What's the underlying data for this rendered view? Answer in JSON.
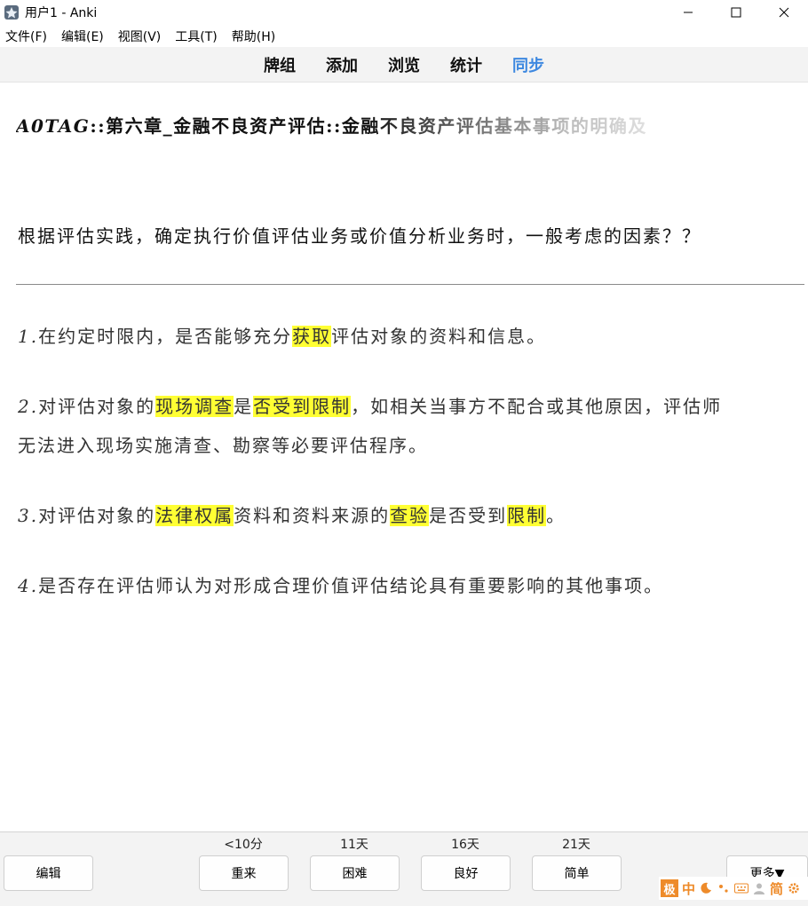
{
  "window": {
    "title": "用户1 - Anki"
  },
  "menu": [
    "文件(F)",
    "编辑(E)",
    "视图(V)",
    "工具(T)",
    "帮助(H)"
  ],
  "toolbar": {
    "decks": "牌组",
    "add": "添加",
    "browse": "浏览",
    "stats": "统计",
    "sync": "同步"
  },
  "card": {
    "deck_tag": "A0TAG",
    "deck_rest": "::第六章_金融不良资产评估::金融不良资产评估基本事项的明确及",
    "question": "根据评估实践，确定执行价值评估业务或价值分析业务时，一般考虑的因素？？",
    "answers": [
      {
        "parts": [
          {
            "text": "1.",
            "hl": false
          },
          {
            "text": "在约定时限内，是否能够充分",
            "hl": false
          },
          {
            "text": "获取",
            "hl": true
          },
          {
            "text": "评估对象的资料和信息。",
            "hl": false
          }
        ]
      },
      {
        "parts": [
          {
            "text": "2.",
            "hl": false
          },
          {
            "text": "对评估对象的",
            "hl": false
          },
          {
            "text": "现场调查",
            "hl": true
          },
          {
            "text": "是",
            "hl": false
          },
          {
            "text": "否受到限制",
            "hl": true
          },
          {
            "text": "，如相关当事方不配合或其他原因，评估师",
            "hl": false
          }
        ],
        "line2": "无法进入现场实施清查、勘察等必要评估程序。"
      },
      {
        "parts": [
          {
            "text": "3.",
            "hl": false
          },
          {
            "text": "对评估对象的",
            "hl": false
          },
          {
            "text": "法律权属",
            "hl": true
          },
          {
            "text": "资料和资料来源的",
            "hl": false
          },
          {
            "text": "查验",
            "hl": true
          },
          {
            "text": "是否受到",
            "hl": false
          },
          {
            "text": "限制",
            "hl": true
          },
          {
            "text": "。",
            "hl": false
          }
        ]
      },
      {
        "parts": [
          {
            "text": "4.",
            "hl": false
          },
          {
            "text": "是否存在评估师认为对形成合理价值评估结论具有重要影响的其他事项。",
            "hl": false
          }
        ]
      }
    ]
  },
  "bottom": {
    "edit": "编辑",
    "again": {
      "label": "重来",
      "interval": "<10分"
    },
    "hard": {
      "label": "困难",
      "interval": "11天"
    },
    "good": {
      "label": "良好",
      "interval": "16天"
    },
    "easy": {
      "label": "简单",
      "interval": "21天"
    },
    "more": "更多▼"
  },
  "ime": {
    "logo": "极",
    "mode": "中",
    "simplified": "简"
  },
  "colors": {
    "highlight": "#ffff33",
    "sync": "#3d88e0",
    "ime": "#ee8b2a"
  }
}
